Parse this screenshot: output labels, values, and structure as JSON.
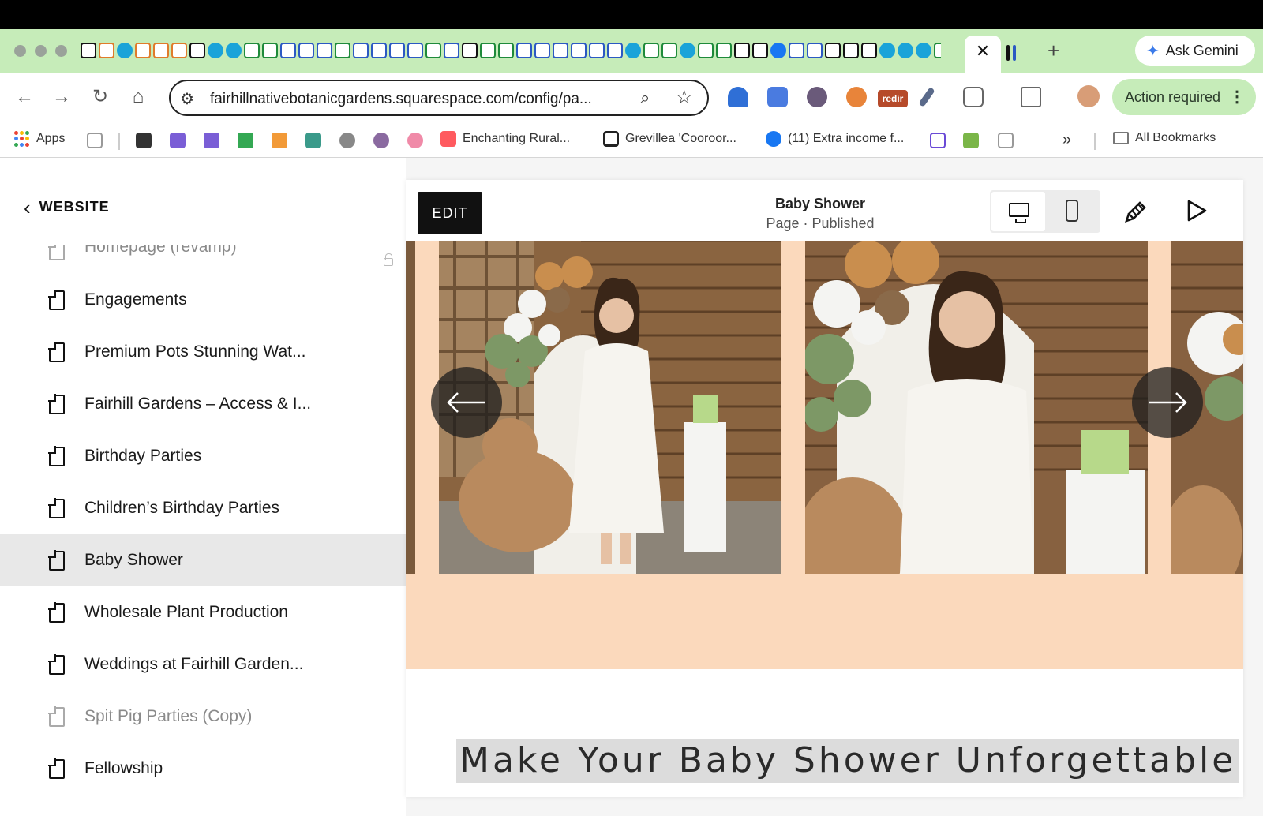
{
  "browser": {
    "gemini_label": "Ask Gemini",
    "url": "fairhillnativebotanicgardens.squarespace.com/config/pa...",
    "action_label": "Action required",
    "redir_label": "redir",
    "close_tab_glyph": "✕",
    "new_tab_glyph": "+"
  },
  "bookmarks": {
    "apps_label": "Apps",
    "items": [
      {
        "label": "Enchanting Rural..."
      },
      {
        "label": "Grevillea 'Cooroor..."
      },
      {
        "label": "(11) Extra income f..."
      }
    ],
    "overflow_glyph": "»",
    "all_label": "All Bookmarks"
  },
  "sidebar": {
    "back_label": "WEBSITE",
    "pages": [
      {
        "label": "Homepage (revamp)",
        "muted": true
      },
      {
        "label": "Engagements"
      },
      {
        "label": "Premium Pots Stunning Wat..."
      },
      {
        "label": "Fairhill Gardens – Access & I..."
      },
      {
        "label": "Birthday Parties"
      },
      {
        "label": "Children’s Birthday Parties"
      },
      {
        "label": "Baby Shower",
        "selected": true
      },
      {
        "label": "Wholesale Plant Production"
      },
      {
        "label": "Weddings at Fairhill Garden..."
      },
      {
        "label": "Spit Pig Parties (Copy)",
        "muted": true
      },
      {
        "label": "Fellowship"
      }
    ]
  },
  "preview": {
    "edit_label": "EDIT",
    "page_title": "Baby Shower",
    "page_status": "Page · Published",
    "headline": "Make Your Baby Shower Unforgettable"
  },
  "colors": {
    "tab_strip": "#c6ecb9",
    "gallery_bg": "#fbd9bc",
    "selected_row": "#e8e8e8"
  }
}
